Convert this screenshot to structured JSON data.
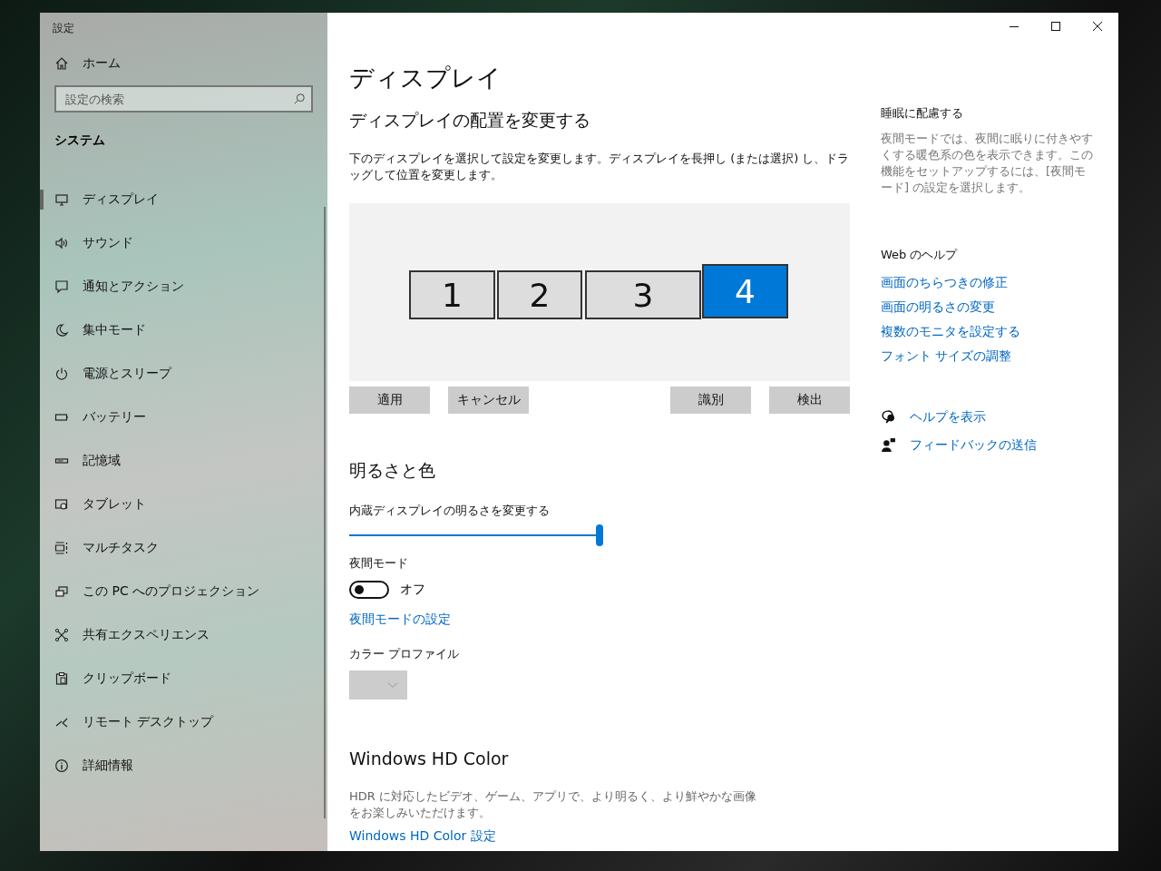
{
  "window": {
    "title": "設定"
  },
  "sidebar": {
    "home": "ホーム",
    "search": {
      "placeholder": "設定の検索"
    },
    "section": "システム",
    "items": [
      {
        "label": "ディスプレイ",
        "selected": true
      },
      {
        "label": "サウンド",
        "selected": false
      },
      {
        "label": "通知とアクション",
        "selected": false
      },
      {
        "label": "集中モード",
        "selected": false
      },
      {
        "label": "電源とスリープ",
        "selected": false
      },
      {
        "label": "バッテリー",
        "selected": false
      },
      {
        "label": "記憶域",
        "selected": false
      },
      {
        "label": "タブレット",
        "selected": false
      },
      {
        "label": "マルチタスク",
        "selected": false
      },
      {
        "label": "この PC へのプロジェクション",
        "selected": false
      },
      {
        "label": "共有エクスペリエンス",
        "selected": false
      },
      {
        "label": "クリップボード",
        "selected": false
      },
      {
        "label": "リモート デスクトップ",
        "selected": false
      },
      {
        "label": "詳細情報",
        "selected": false
      }
    ]
  },
  "main": {
    "title": "ディスプレイ",
    "arrangement": {
      "heading": "ディスプレイの配置を変更する",
      "description": "下のディスプレイを選択して設定を変更します。ディスプレイを長押し (または選択) し、ドラッグして位置を変更します。",
      "monitors": [
        {
          "label": "1",
          "selected": false
        },
        {
          "label": "2",
          "selected": false
        },
        {
          "label": "3",
          "selected": false
        },
        {
          "label": "4",
          "selected": true
        }
      ],
      "buttons": [
        "適用",
        "キャンセル",
        "識別",
        "検出"
      ]
    },
    "brightness": {
      "heading": "明るさと色",
      "slider_label": "内蔵ディスプレイの明るさを変更する",
      "level": 1,
      "night_mode": {
        "label": "夜間モード",
        "on": false,
        "state": "オフ"
      },
      "night_mode_link": "夜間モードの設定",
      "color_profile": {
        "label": "カラー プロファイル",
        "disabled": true
      }
    },
    "hd_color": {
      "heading": "Windows HD Color",
      "description": "HDR に対応したビデオ、ゲーム、アプリで、より明るく、より鮮やかな画像をお楽しみいただけます。",
      "link": "Windows HD Color 設定"
    }
  },
  "aside": {
    "sleep": {
      "heading": "睡眠に配慮する",
      "description": "夜間モードでは、夜間に眠りに付きやすくする暖色系の色を表示できます。この機能をセットアップするには、[夜間モード] の設定を選択します。"
    },
    "web_help": {
      "heading": "Web のヘルプ",
      "links": [
        "画面のちらつきの修正",
        "画面の明るさの変更",
        "複数のモニタを設定する",
        "フォント サイズの調整"
      ]
    },
    "actions": [
      "ヘルプを表示",
      "フィードバックの送信"
    ]
  }
}
